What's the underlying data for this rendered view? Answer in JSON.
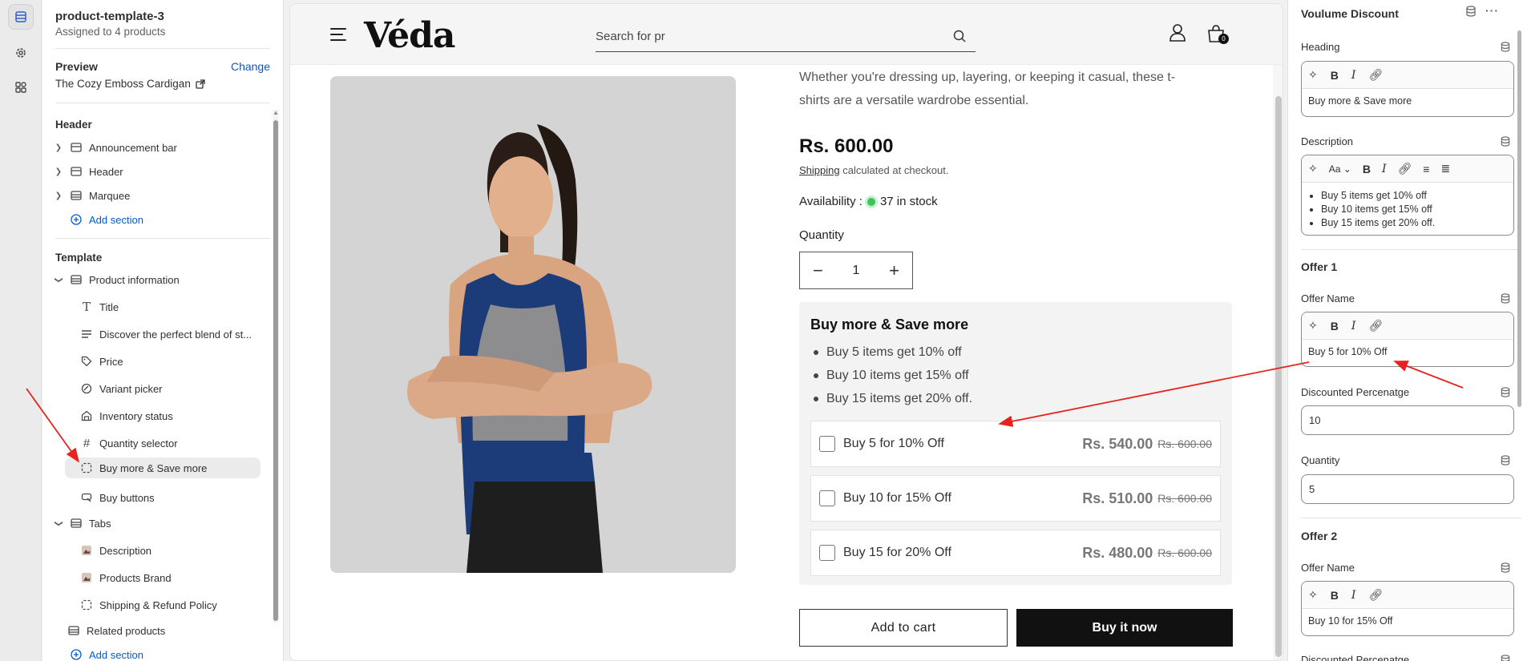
{
  "left_panel": {
    "template_name": "product-template-3",
    "assigned": "Assigned to 4 products",
    "preview_label": "Preview",
    "change_label": "Change",
    "preview_product": "The Cozy Emboss Cardigan",
    "header_section_title": "Header",
    "header_items": [
      {
        "label": "Announcement bar",
        "icon": "section-icon"
      },
      {
        "label": "Header",
        "icon": "section-icon"
      },
      {
        "label": "Marquee",
        "icon": "section-icon"
      }
    ],
    "add_section": "Add section",
    "template_section_title": "Template",
    "product_info": "Product information",
    "blocks": [
      {
        "label": "Title",
        "icon": "text-icon"
      },
      {
        "label": "Discover the perfect blend of st...",
        "icon": "paragraph-icon"
      },
      {
        "label": "Price",
        "icon": "price-tag-icon"
      },
      {
        "label": "Variant picker",
        "icon": "variant-icon"
      },
      {
        "label": "Inventory status",
        "icon": "inventory-icon"
      },
      {
        "label": "Quantity selector",
        "icon": "hash-icon"
      },
      {
        "label": "Buy more & Save more",
        "icon": "app-block-icon"
      },
      {
        "label": "Buy buttons",
        "icon": "buy-button-icon"
      }
    ],
    "tabs_label": "Tabs",
    "tab_blocks": [
      {
        "label": "Description",
        "icon": "image-icon"
      },
      {
        "label": "Products Brand",
        "icon": "image-icon"
      },
      {
        "label": "Shipping & Refund Policy",
        "icon": "app-block-icon"
      }
    ],
    "related_products": "Related products",
    "add_section_2": "Add section"
  },
  "storefront": {
    "logo": "Véda",
    "search_placeholder": "Search for pr",
    "cart_count": "0",
    "description_lines": "fabrics that feel soft against the skin and offer all-day comfort. Whether you're dressing up, layering, or keeping it casual, these t-shirts are a versatile wardrobe essential.",
    "price": "Rs. 600.00",
    "shipping_link": "Shipping",
    "shipping_text": "calculated at checkout.",
    "availability_label": "Availability :",
    "stock": "37 in stock",
    "quantity_label": "Quantity",
    "quantity_value": "1",
    "volume_discount": {
      "title": "Buy more & Save more",
      "bullets": [
        "Buy 5 items get 10% off",
        "Buy 10 items get 15% off",
        "Buy 15 items get 20% off."
      ],
      "offers": [
        {
          "name": "Buy 5 for 10% Off",
          "price": "Rs. 540.00",
          "old": "Rs. 600.00"
        },
        {
          "name": "Buy 10 for 15% Off",
          "price": "Rs. 510.00",
          "old": "Rs. 600.00"
        },
        {
          "name": "Buy 15 for 20% Off",
          "price": "Rs. 480.00",
          "old": "Rs. 600.00"
        }
      ]
    },
    "add_to_cart": "Add to cart",
    "buy_now": "Buy it now"
  },
  "right_panel": {
    "title": "Voulume Discount",
    "heading_label": "Heading",
    "heading_value": "Buy more & Save more",
    "description_label": "Description",
    "description_bullets": [
      "Buy 5 items get 10% off",
      "Buy 10 items  get 15% off",
      "Buy 15 items get 20% off."
    ],
    "font_btn": "Aa",
    "offer1_title": "Offer 1",
    "offer_name_label": "Offer Name",
    "offer1_name": "Buy 5 for 10% Off",
    "discount_label": "Discounted Percenatge",
    "offer1_discount": "10",
    "quantity_label": "Quantity",
    "offer1_quantity": "5",
    "offer2_title": "Offer 2",
    "offer2_name_label": "Offer Name",
    "offer2_name": "Buy 10 for 15% Off",
    "offer2_discount_label": "Discounted Percenatge"
  },
  "colors": {
    "accent": "#005bd3",
    "annotation": "#e8231f",
    "stock_dot": "#3ec35a"
  }
}
